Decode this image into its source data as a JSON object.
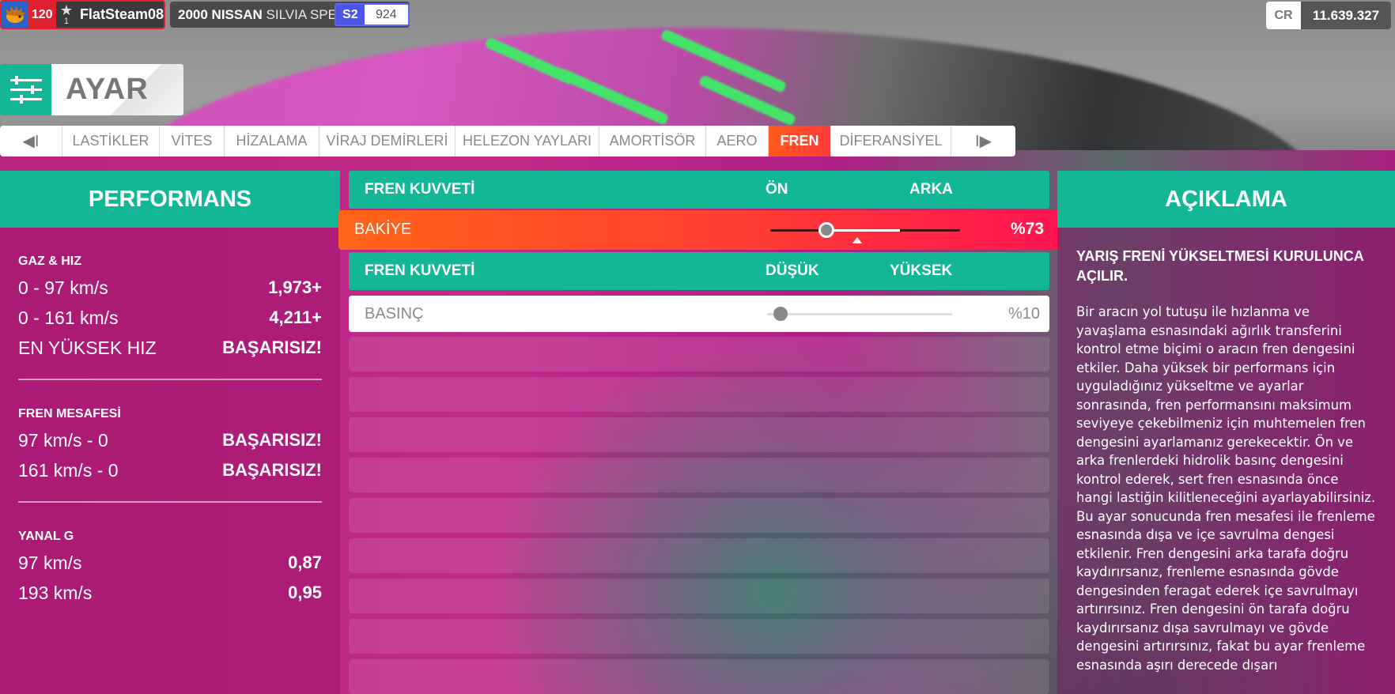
{
  "player": {
    "level": "120",
    "rank": "1",
    "gamertag": "FlatSteam08"
  },
  "car": {
    "year_make": "2000 NISSAN",
    "model": "SILVIA SPEC-R",
    "class": "S2",
    "pi": "924"
  },
  "credits": {
    "label": "CR",
    "value": "11.639.327"
  },
  "page": {
    "title": "AYAR",
    "icon": "sliders-icon"
  },
  "tabs": {
    "prev": "◀I",
    "next": "I▶",
    "items": [
      "LASTİKLER",
      "VİTES",
      "HİZALAMA",
      "VİRAJ DEMİRLERİ",
      "HELEZON YAYLARI",
      "AMORTİSÖR",
      "AERO",
      "FREN",
      "DİFERANSİYEL"
    ],
    "active": "FREN"
  },
  "performance": {
    "title": "PERFORMANS",
    "sections": [
      {
        "title": "GAZ & HIZ",
        "rows": [
          {
            "label": "0 - 97 km/s",
            "value": "1,973+"
          },
          {
            "label": "0 - 161 km/s",
            "value": "4,211+"
          },
          {
            "label": "EN YÜKSEK HIZ",
            "value": "BAŞARISIZ!"
          }
        ]
      },
      {
        "title": "FREN MESAFESİ",
        "rows": [
          {
            "label": "97 km/s - 0",
            "value": "BAŞARISIZ!"
          },
          {
            "label": "161 km/s - 0",
            "value": "BAŞARISIZ!"
          }
        ]
      },
      {
        "title": "YANAL G",
        "rows": [
          {
            "label": "97 km/s",
            "value": "0,87"
          },
          {
            "label": "193 km/s",
            "value": "0,95"
          }
        ]
      }
    ]
  },
  "tuning": {
    "groups": [
      {
        "title": "FREN KUVVETİ",
        "col_a": "ÖN",
        "col_b": "ARKA",
        "setting": {
          "label": "BAKİYE",
          "value": "%73",
          "level": 0.3
        }
      },
      {
        "title": "FREN KUVVETİ",
        "col_a": "DÜŞÜK",
        "col_b": "YÜKSEK",
        "setting": {
          "label": "BASINÇ",
          "value": "%10",
          "level": 0.06
        }
      }
    ]
  },
  "description": {
    "title": "AÇIKLAMA",
    "heading": "YARIŞ FRENİ YÜKSELTMESİ KURULUNCA AÇILIR.",
    "text": "Bir aracın yol tutuşu ile hızlanma ve yavaşlama esnasındaki ağırlık transferini kontrol etme biçimi o aracın fren dengesini etkiler. Daha yüksek bir performans için uyguladığınız yükseltme ve ayarlar sonrasında, fren performansını maksimum seviyeye çekebilmeniz için muhtemelen fren dengesini ayarlamanız gerekecektir. Ön ve arka frenlerdeki hidrolik basınç dengesini kontrol ederek, sert fren esnasında önce hangi lastiğin kilitleneceğini ayarlayabilirsiniz. Bu ayar sonucunda fren mesafesi ile frenleme esnasında dışa ve içe savrulma dengesi etkilenir. Fren dengesini arka tarafa doğru kaydırırsanız, frenleme esnasında gövde dengesinden feragat ederek içe savrulmayı artırırsınız. Fren dengesini ön tarafa doğru kaydırırsanız dışa savrulmayı ve gövde dengesini artırırsınız, fakat bu ayar frenleme esnasında aşırı derecede dışarı"
  },
  "colors": {
    "accent": "#14b795",
    "active_tab": "#ff5a1e",
    "player_red": "#e0202e",
    "class_blue": "#4b56e8"
  }
}
